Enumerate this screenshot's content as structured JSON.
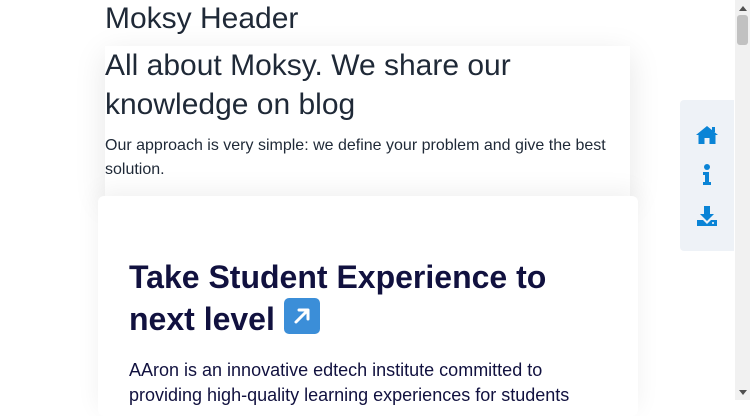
{
  "header": {
    "title": "Moksy Header"
  },
  "hero": {
    "heading": "All about Moksy. We share our knowledge on blog",
    "description": "Our approach is very simple: we define your problem and give the best solution."
  },
  "feature": {
    "heading": "Take Student Experience to next level",
    "heading_emoji": "↗️",
    "body": "AAron is an innovative edtech institute committed to providing high-quality learning experiences for students"
  },
  "side_nav": {
    "icons": [
      "home-icon",
      "info-icon",
      "download-icon"
    ],
    "accent_color": "#0a84d6"
  },
  "colors": {
    "text_dark": "#1f2937",
    "heading_navy": "#11113f",
    "nav_bg": "#eef2f7"
  }
}
